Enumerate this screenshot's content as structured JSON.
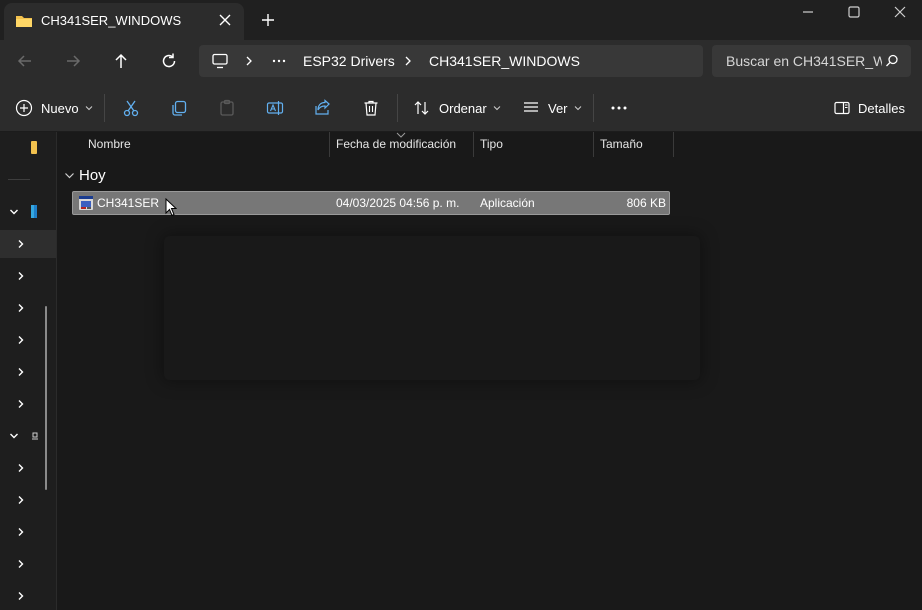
{
  "tab": {
    "title": "CH341SER_WINDOWS"
  },
  "breadcrumb": {
    "items": [
      "ESP32 Drivers",
      "CH341SER_WINDOWS"
    ]
  },
  "search": {
    "placeholder": "Buscar en CH341SER_W"
  },
  "toolbar": {
    "new_label": "Nuevo",
    "sort_label": "Ordenar",
    "view_label": "Ver",
    "details_label": "Detalles"
  },
  "columns": [
    "Nombre",
    "Fecha de modificación",
    "Tipo",
    "Tamaño"
  ],
  "group": {
    "label": "Hoy"
  },
  "files": [
    {
      "name": "CH341SER",
      "modified": "04/03/2025 04:56 p. m.",
      "type": "Aplicación",
      "size": "806 KB"
    }
  ],
  "colors": {
    "background": "#191919",
    "chrome": "#2c2c2c",
    "folder": "#f2c14e",
    "selection": "#777777"
  }
}
